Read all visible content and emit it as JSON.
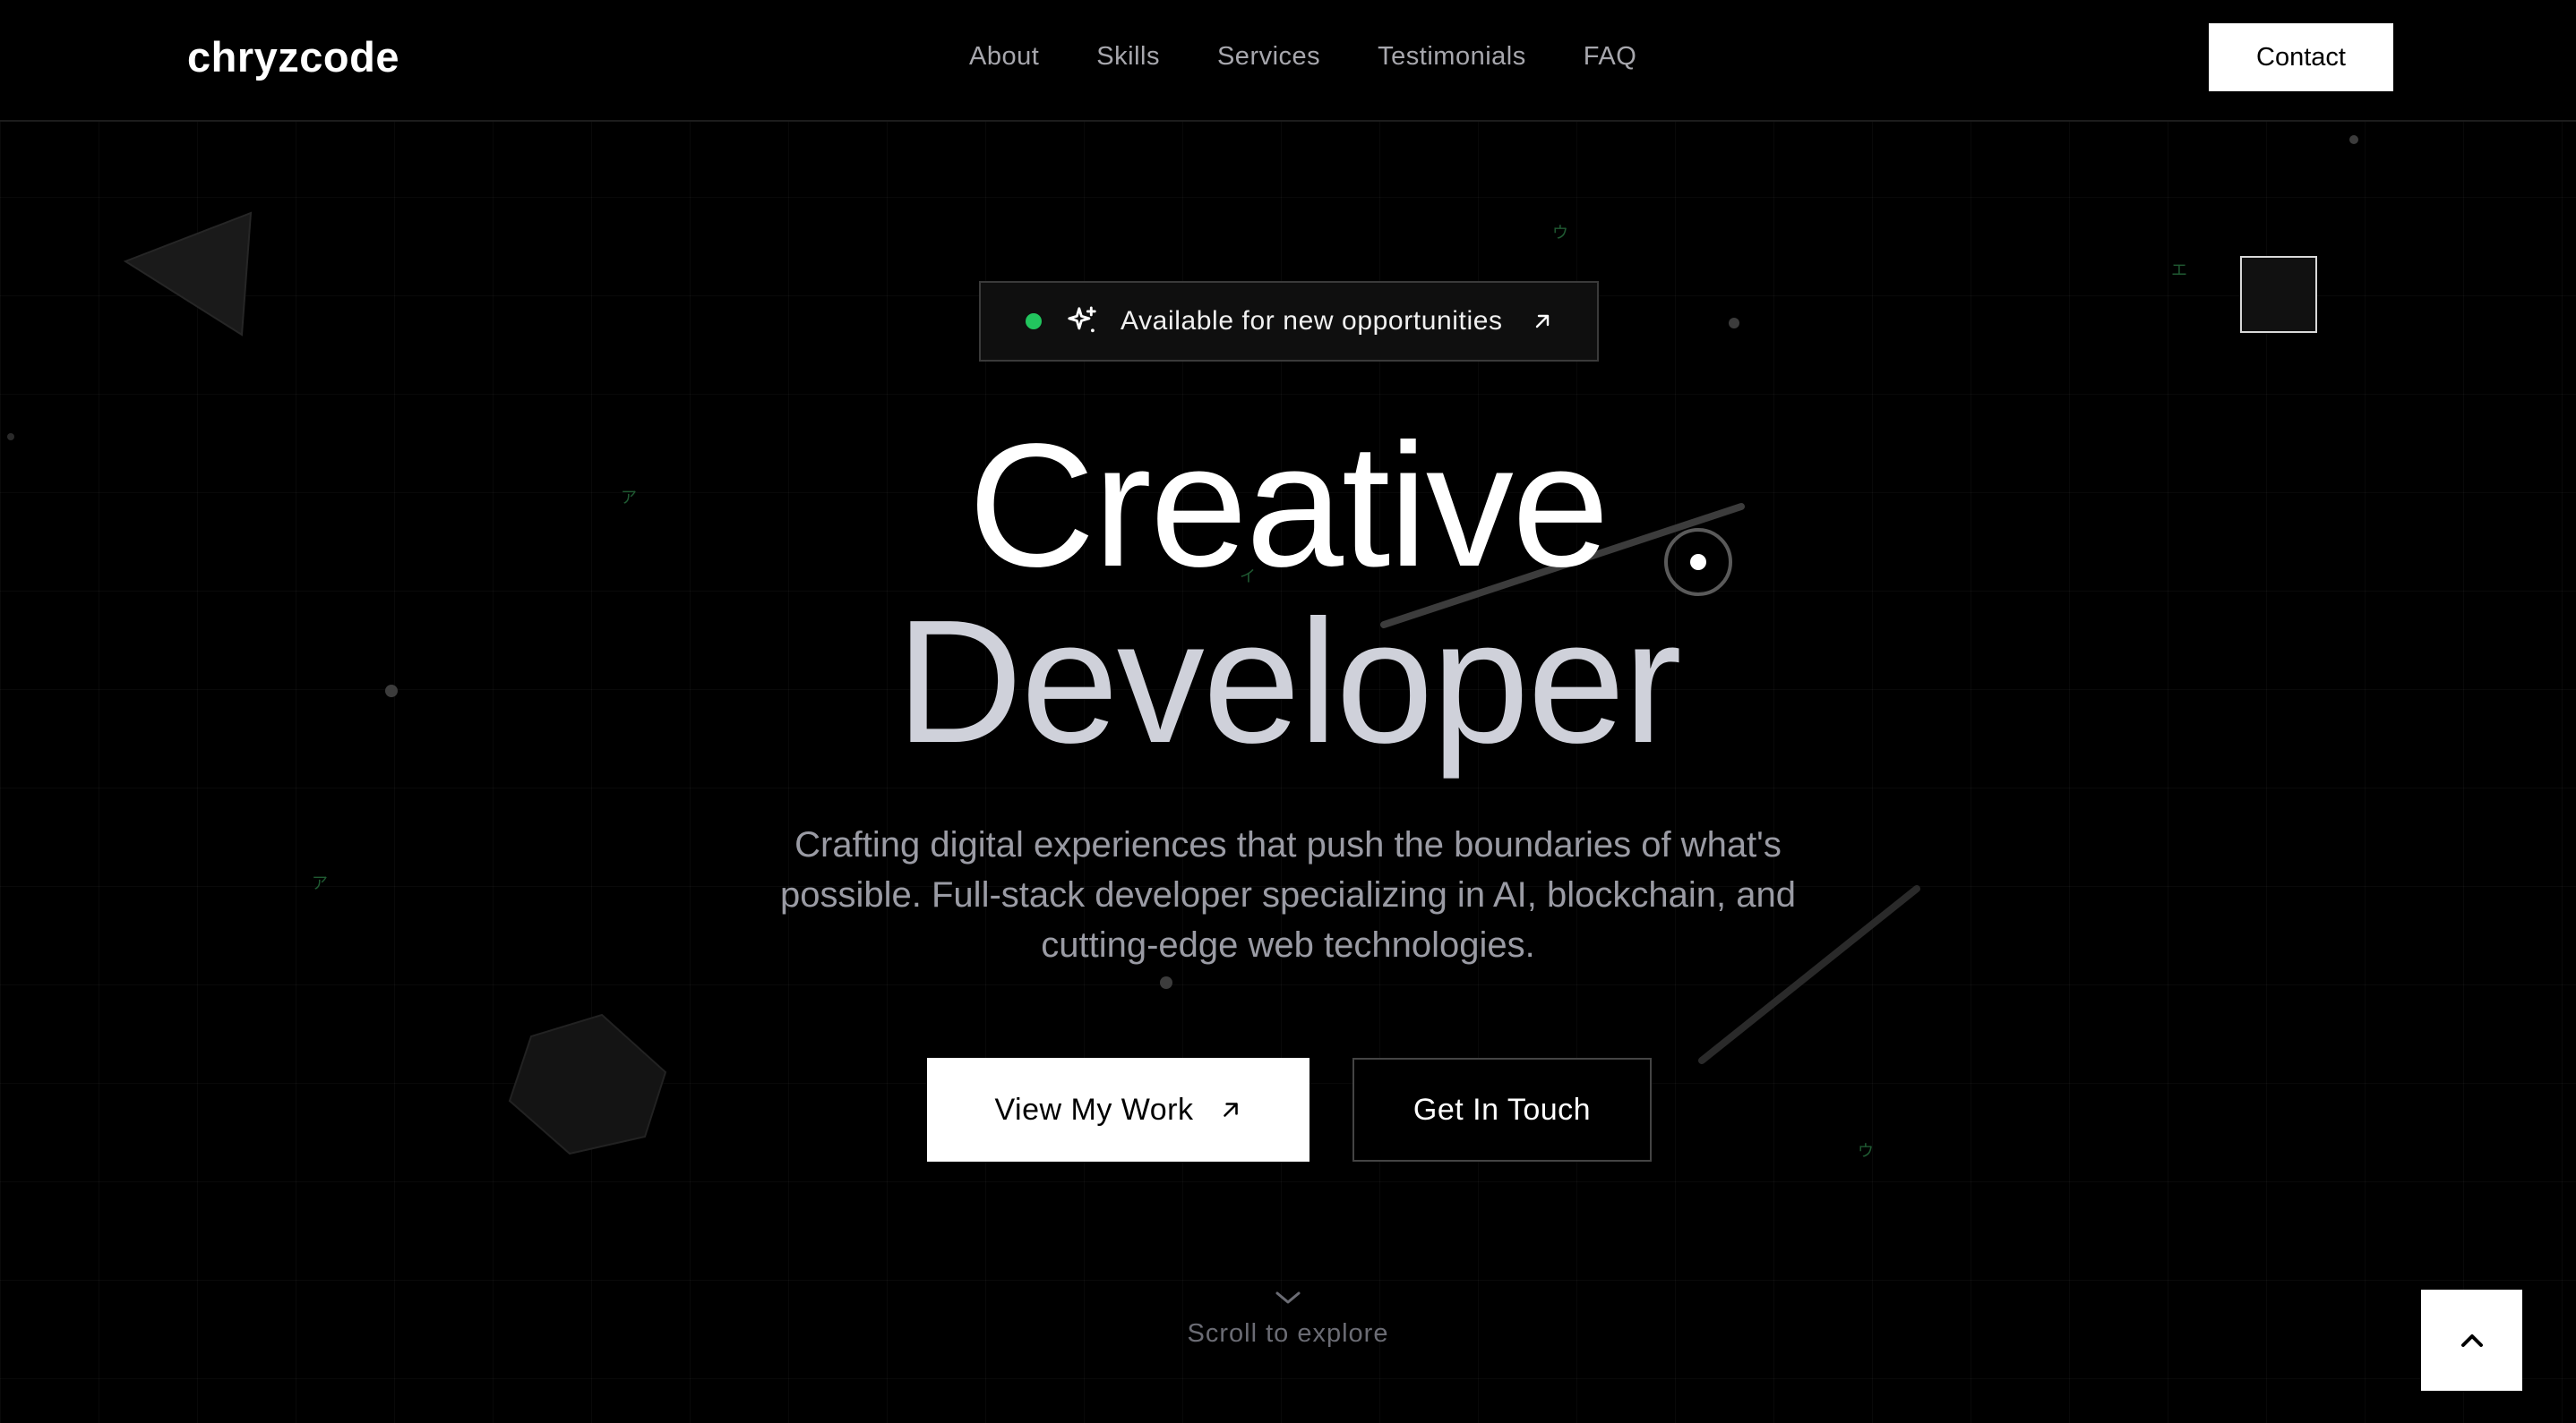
{
  "header": {
    "logo": "chryzcode",
    "nav": [
      {
        "label": "About"
      },
      {
        "label": "Skills"
      },
      {
        "label": "Services"
      },
      {
        "label": "Testimonials"
      },
      {
        "label": "FAQ"
      }
    ],
    "contact_label": "Contact"
  },
  "hero": {
    "badge": {
      "status_color": "#22c55e",
      "icon_left": "sparkles-icon",
      "text": "Available for new opportunities",
      "icon_right": "arrow-up-right-icon"
    },
    "title_line1": "Creative",
    "title_line2": "Developer",
    "subtitle": "Crafting digital experiences that push the boundaries of what's possible. Full-stack developer specializing in AI, blockchain, and cutting-edge web technologies.",
    "primary_button": {
      "label": "View My Work",
      "icon": "arrow-up-right-icon"
    },
    "secondary_button": {
      "label": "Get In Touch"
    },
    "scroll_hint": {
      "icon": "chevron-down-icon",
      "text": "Scroll to explore"
    }
  },
  "back_to_top": {
    "icon": "chevron-up-icon"
  },
  "background": {
    "glyphs": [
      "ウ",
      "エ",
      "ア",
      "イ",
      "ア",
      "ウ"
    ]
  },
  "colors": {
    "background": "#000000",
    "accent": "#22c55e",
    "title_primary": "#ffffff",
    "title_secondary": "#cfd1da",
    "muted_text": "#9a9ba4"
  }
}
